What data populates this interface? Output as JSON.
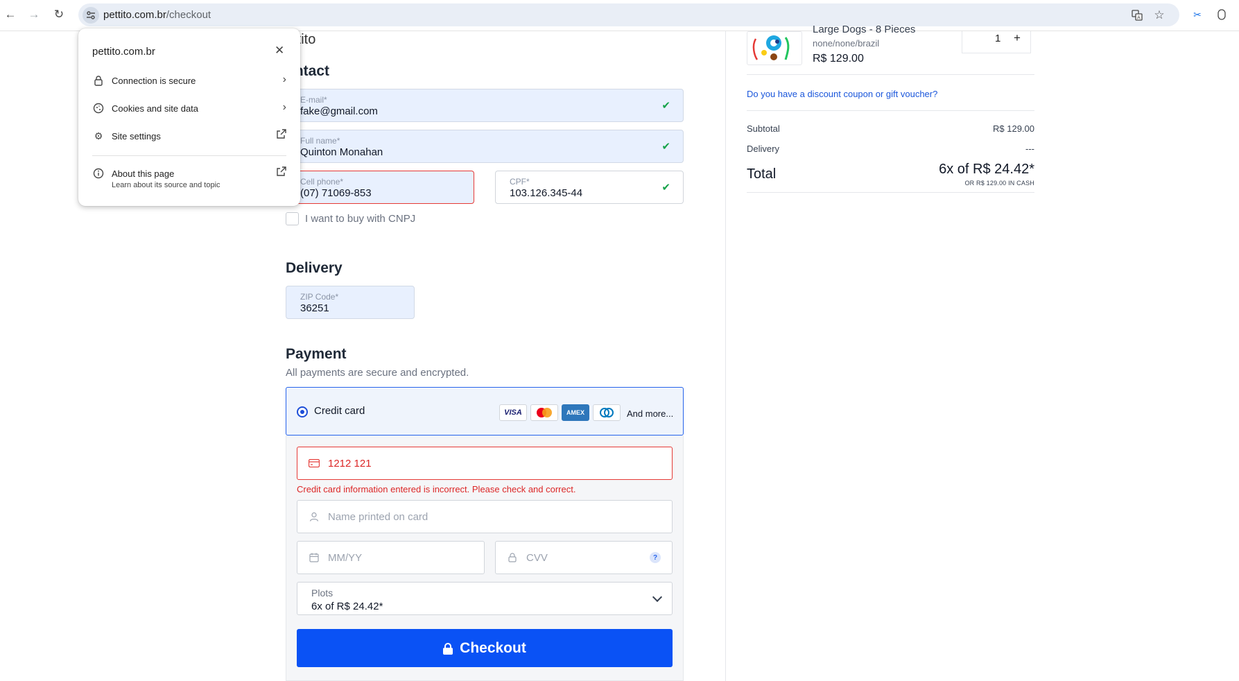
{
  "browser": {
    "url_host": "pettito.com.br",
    "url_path": "/checkout"
  },
  "popup": {
    "title": "pettito.com.br",
    "items": [
      {
        "label": "Connection is secure"
      },
      {
        "label": "Cookies and site data"
      },
      {
        "label": "Site settings"
      }
    ],
    "about": {
      "label": "About this page",
      "sub": "Learn about its source and topic"
    }
  },
  "brand": "ettito",
  "contact": {
    "title": "ontact",
    "email": {
      "label": "E-mail*",
      "value": "fake@gmail.com"
    },
    "name": {
      "label": "Full name*",
      "value": "Quinton Monahan"
    },
    "phone": {
      "label": "Cell phone*",
      "value": "(07) 71069-853"
    },
    "cpf": {
      "label": "CPF*",
      "value": "103.126.345-44"
    },
    "cnpj_label": "I want to buy with CNPJ"
  },
  "delivery": {
    "title": "Delivery",
    "zip": {
      "label": "ZIP Code*",
      "value": "36251"
    }
  },
  "payment": {
    "title": "Payment",
    "subtitle": "All payments are secure and encrypted.",
    "method_label": "Credit card",
    "logos": [
      "VISA",
      "MC",
      "AMEX",
      "DC"
    ],
    "and_more": "And more...",
    "card_number": "1212 121",
    "card_error": "Credit card information entered is incorrect. Please check and correct.",
    "name_placeholder": "Name printed on card",
    "expiry_placeholder": "MM/YY",
    "cvv_placeholder": "CVV",
    "cvv_help": "?",
    "plots_label": "Plots",
    "plots_value": "6x of R$ 24.42*",
    "checkout_label": "Checkout"
  },
  "summary": {
    "product_name": "Large Dogs - 8 Pieces",
    "product_variant": "none/none/brazil",
    "product_price": "R$ 129.00",
    "quantity": "1",
    "qty_plus": "+",
    "coupon": "Do you have a discount coupon or gift voucher?",
    "subtotal_label": "Subtotal",
    "subtotal_value": "R$ 129.00",
    "delivery_label": "Delivery",
    "delivery_value": "---",
    "total_label": "Total",
    "total_value": "6x of R$ 24.42*",
    "total_cash": "OR R$ 129.00 IN CASH"
  },
  "colors": {
    "accent": "#0a52f5",
    "error": "#e53935",
    "success": "#16a34a",
    "link": "#1a56db"
  }
}
